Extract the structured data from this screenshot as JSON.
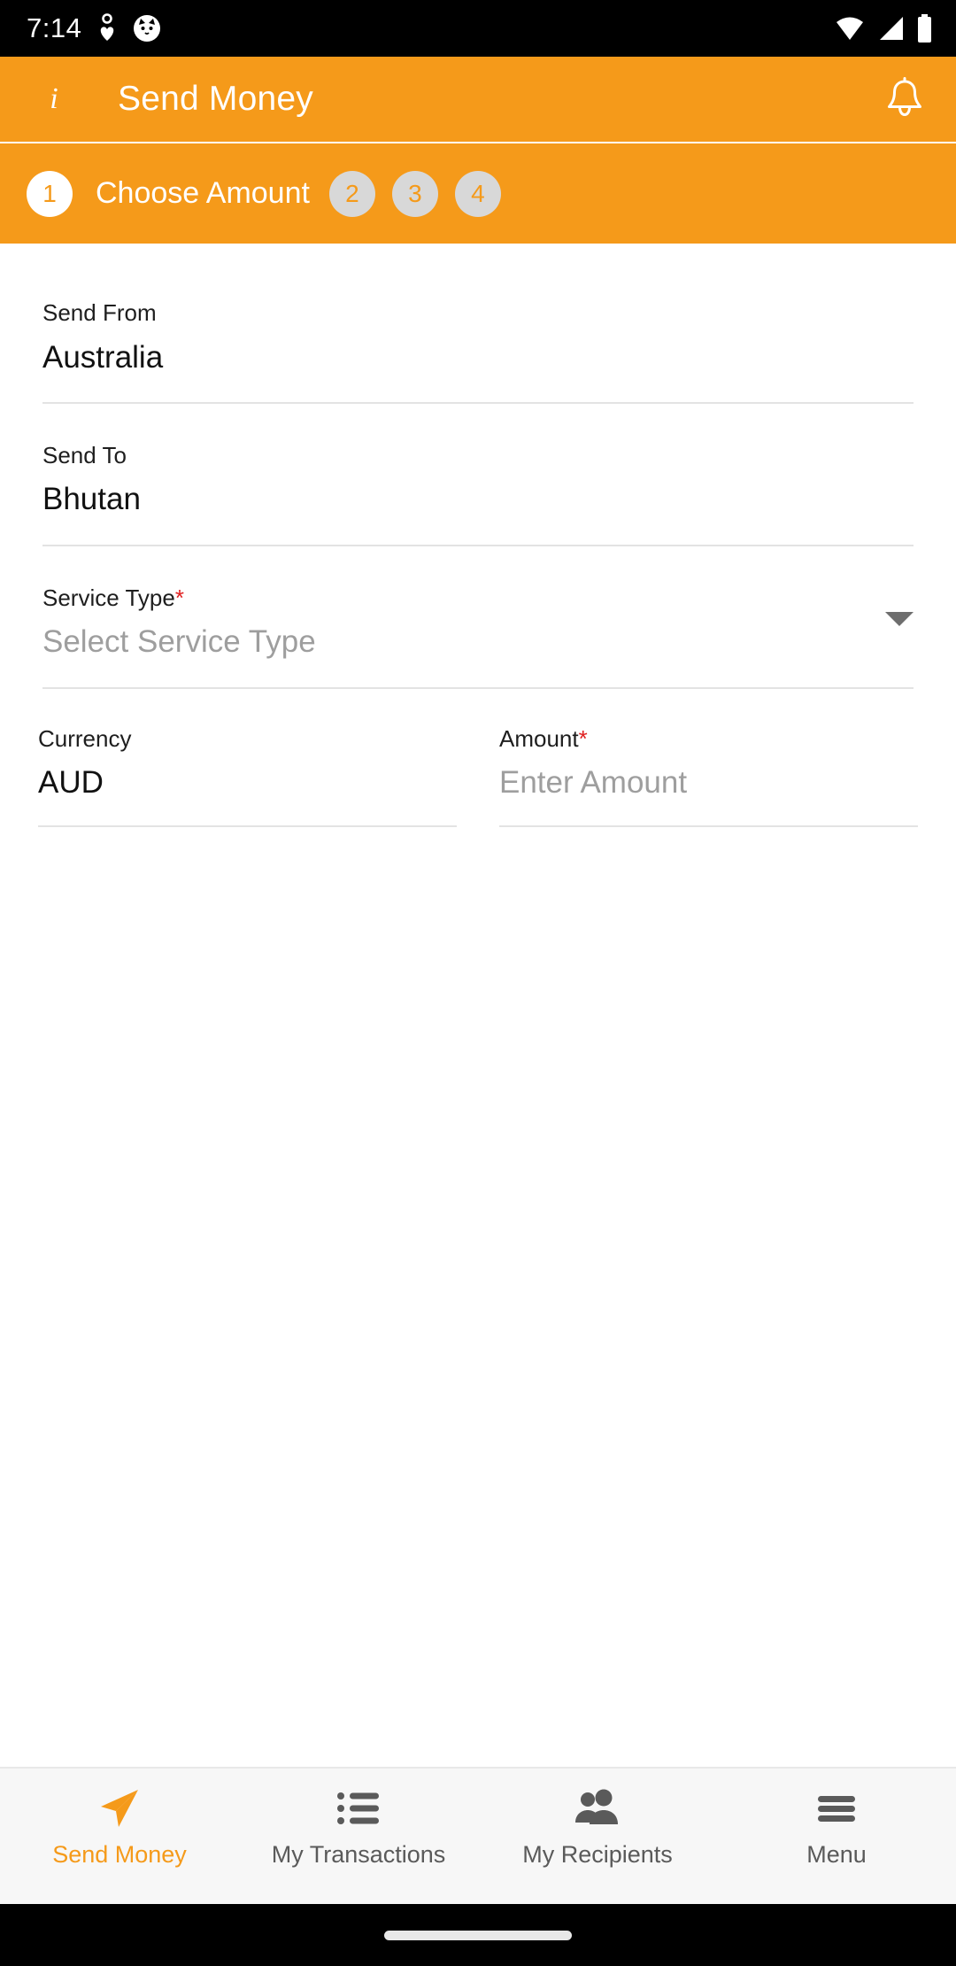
{
  "statusbar": {
    "time": "7:14",
    "left_icons": [
      "heart-pin-icon",
      "cat-face-icon"
    ],
    "right_icons": [
      "wifi-icon",
      "cellular-signal-icon",
      "battery-icon"
    ]
  },
  "appbar": {
    "info_icon": "info-icon",
    "info_label": "i",
    "title": "Send Money",
    "bell_icon": "notification-bell-icon",
    "background_color": "#f59a1a"
  },
  "stepper": {
    "current_step": 1,
    "active_label": "Choose Amount",
    "steps": [
      {
        "number": "1",
        "label": "Choose Amount",
        "state": "active"
      },
      {
        "number": "2",
        "label": "",
        "state": "inactive"
      },
      {
        "number": "3",
        "label": "",
        "state": "inactive"
      },
      {
        "number": "4",
        "label": "",
        "state": "inactive"
      }
    ],
    "active_circle_color": "#ffffff",
    "inactive_circle_color": "#d8d8d8",
    "number_color": "#f59a1a"
  },
  "form": {
    "send_from": {
      "label": "Send From",
      "value": "Australia",
      "required": false
    },
    "send_to": {
      "label": "Send To",
      "value": "Bhutan",
      "required": false
    },
    "service_type": {
      "label": "Service Type",
      "required_mark": "*",
      "placeholder": "Select Service Type",
      "value": "",
      "dropdown_icon": "chevron-down-icon"
    },
    "currency": {
      "label": "Currency",
      "value": "AUD",
      "required": false
    },
    "amount": {
      "label": "Amount",
      "required_mark": "*",
      "placeholder": "Enter Amount",
      "value": ""
    },
    "required_color": "#e02020",
    "placeholder_color": "#9e9e9e"
  },
  "bottomnav": {
    "active_index": 0,
    "active_color": "#f59a1a",
    "inactive_color": "#5a5a5a",
    "items": [
      {
        "label": "Send Money",
        "icon": "paper-plane-icon"
      },
      {
        "label": "My Transactions",
        "icon": "list-icon"
      },
      {
        "label": "My Recipients",
        "icon": "people-icon"
      },
      {
        "label": "Menu",
        "icon": "hamburger-menu-icon"
      }
    ]
  }
}
